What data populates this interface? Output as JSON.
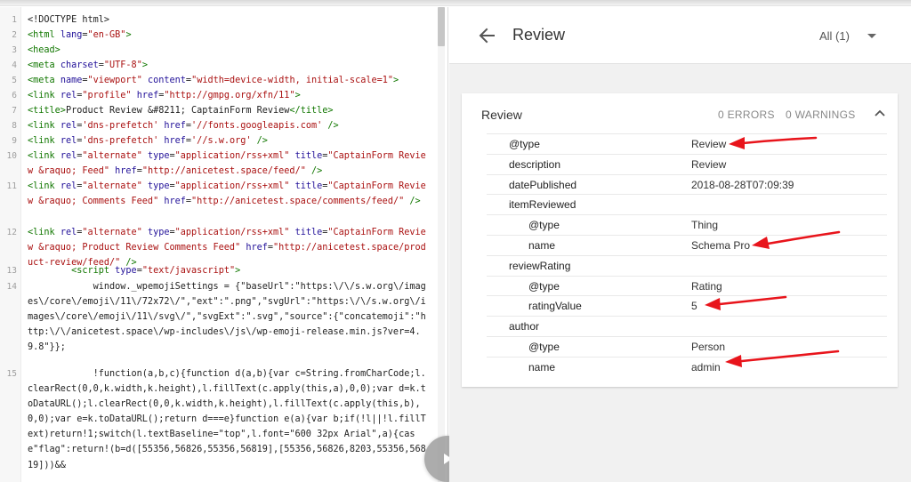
{
  "code": {
    "lines": [
      {
        "n": "1",
        "segs": [
          {
            "t": "<!DOCTYPE html>",
            "c": "plain"
          }
        ]
      },
      {
        "n": "2",
        "segs": [
          {
            "t": "<html ",
            "c": "tag"
          },
          {
            "t": "lang",
            "c": "attr"
          },
          {
            "t": "=",
            "c": "plain"
          },
          {
            "t": "\"en-GB\"",
            "c": "str"
          },
          {
            "t": ">",
            "c": "tag"
          }
        ]
      },
      {
        "n": "3",
        "segs": [
          {
            "t": "<head>",
            "c": "tag"
          }
        ]
      },
      {
        "n": "4",
        "segs": [
          {
            "t": "<meta ",
            "c": "tag"
          },
          {
            "t": "charset",
            "c": "attr"
          },
          {
            "t": "=",
            "c": "plain"
          },
          {
            "t": "\"UTF-8\"",
            "c": "str"
          },
          {
            "t": ">",
            "c": "tag"
          }
        ]
      },
      {
        "n": "5",
        "segs": [
          {
            "t": "<meta ",
            "c": "tag"
          },
          {
            "t": "name",
            "c": "attr"
          },
          {
            "t": "=",
            "c": "plain"
          },
          {
            "t": "\"viewport\"",
            "c": "str"
          },
          {
            "t": " content",
            "c": "attr"
          },
          {
            "t": "=",
            "c": "plain"
          },
          {
            "t": "\"width=device-width, initial-scale=1\"",
            "c": "str"
          },
          {
            "t": ">",
            "c": "tag"
          }
        ]
      },
      {
        "n": "6",
        "segs": [
          {
            "t": "<link ",
            "c": "tag"
          },
          {
            "t": "rel",
            "c": "attr"
          },
          {
            "t": "=",
            "c": "plain"
          },
          {
            "t": "\"profile\"",
            "c": "str"
          },
          {
            "t": " href",
            "c": "attr"
          },
          {
            "t": "=",
            "c": "plain"
          },
          {
            "t": "\"http://gmpg.org/xfn/11\"",
            "c": "str"
          },
          {
            "t": ">",
            "c": "tag"
          }
        ]
      },
      {
        "n": "7",
        "segs": [
          {
            "t": "<title>",
            "c": "tag"
          },
          {
            "t": "Product Review &#8211; CaptainForm Review",
            "c": "plain"
          },
          {
            "t": "</title>",
            "c": "tag"
          }
        ]
      },
      {
        "n": "8",
        "segs": [
          {
            "t": "<link ",
            "c": "tag"
          },
          {
            "t": "rel",
            "c": "attr"
          },
          {
            "t": "=",
            "c": "plain"
          },
          {
            "t": "'dns-prefetch'",
            "c": "str"
          },
          {
            "t": " href",
            "c": "attr"
          },
          {
            "t": "=",
            "c": "plain"
          },
          {
            "t": "'//fonts.googleapis.com'",
            "c": "str"
          },
          {
            "t": " />",
            "c": "tag"
          }
        ]
      },
      {
        "n": "9",
        "segs": [
          {
            "t": "<link ",
            "c": "tag"
          },
          {
            "t": "rel",
            "c": "attr"
          },
          {
            "t": "=",
            "c": "plain"
          },
          {
            "t": "'dns-prefetch'",
            "c": "str"
          },
          {
            "t": " href",
            "c": "attr"
          },
          {
            "t": "=",
            "c": "plain"
          },
          {
            "t": "'//s.w.org'",
            "c": "str"
          },
          {
            "t": " />",
            "c": "tag"
          }
        ]
      },
      {
        "n": "10",
        "segs": [
          {
            "t": "<link ",
            "c": "tag"
          },
          {
            "t": "rel",
            "c": "attr"
          },
          {
            "t": "=",
            "c": "plain"
          },
          {
            "t": "\"alternate\"",
            "c": "str"
          },
          {
            "t": " type",
            "c": "attr"
          },
          {
            "t": "=",
            "c": "plain"
          },
          {
            "t": "\"application/rss+xml\"",
            "c": "str"
          },
          {
            "t": " title",
            "c": "attr"
          },
          {
            "t": "=",
            "c": "plain"
          },
          {
            "t": "\"CaptainForm Review &raquo; Feed\"",
            "c": "str"
          },
          {
            "t": " href",
            "c": "attr"
          },
          {
            "t": "=",
            "c": "plain"
          },
          {
            "t": "\"http://anicetest.space/feed/\"",
            "c": "str"
          },
          {
            "t": " />",
            "c": "tag"
          }
        ]
      },
      {
        "n": "11",
        "segs": [
          {
            "t": "<link ",
            "c": "tag"
          },
          {
            "t": "rel",
            "c": "attr"
          },
          {
            "t": "=",
            "c": "plain"
          },
          {
            "t": "\"alternate\"",
            "c": "str"
          },
          {
            "t": " type",
            "c": "attr"
          },
          {
            "t": "=",
            "c": "plain"
          },
          {
            "t": "\"application/rss+xml\"",
            "c": "str"
          },
          {
            "t": " title",
            "c": "attr"
          },
          {
            "t": "=",
            "c": "plain"
          },
          {
            "t": "\"CaptainForm Review &raquo; Comments Feed\"",
            "c": "str"
          },
          {
            "t": " href",
            "c": "attr"
          },
          {
            "t": "=",
            "c": "plain"
          },
          {
            "t": "\"http://anicetest.space/comments/feed/\"",
            "c": "str"
          },
          {
            "t": " />",
            "c": "tag"
          }
        ]
      },
      {
        "n": "12",
        "segs": [
          {
            "t": "<link ",
            "c": "tag"
          },
          {
            "t": "rel",
            "c": "attr"
          },
          {
            "t": "=",
            "c": "plain"
          },
          {
            "t": "\"alternate\"",
            "c": "str"
          },
          {
            "t": " type",
            "c": "attr"
          },
          {
            "t": "=",
            "c": "plain"
          },
          {
            "t": "\"application/rss+xml\"",
            "c": "str"
          },
          {
            "t": " title",
            "c": "attr"
          },
          {
            "t": "=",
            "c": "plain"
          },
          {
            "t": "\"CaptainForm Review &raquo; Product Review Comments Feed\"",
            "c": "str"
          },
          {
            "t": " href",
            "c": "attr"
          },
          {
            "t": "=",
            "c": "plain"
          },
          {
            "t": "\"http://anicetest.space/product-review/feed/\"",
            "c": "str"
          },
          {
            "t": " />",
            "c": "tag"
          }
        ]
      },
      {
        "n": "13",
        "segs": [
          {
            "t": "        <script ",
            "c": "tag"
          },
          {
            "t": "type",
            "c": "attr"
          },
          {
            "t": "=",
            "c": "plain"
          },
          {
            "t": "\"text/javascript\"",
            "c": "str"
          },
          {
            "t": ">",
            "c": "tag"
          }
        ]
      },
      {
        "n": "14",
        "segs": [
          {
            "t": "            window._wpemojiSettings = {\"baseUrl\":\"https:\\/\\/s.w.org\\/images\\/core\\/emoji\\/11\\/72x72\\/\",\"ext\":\".png\",\"svgUrl\":\"https:\\/\\/s.w.org\\/images\\/core\\/emoji\\/11\\/svg\\/\",\"svgExt\":\".svg\",\"source\":{\"concatemoji\":\"http:\\/\\/anicetest.space\\/wp-includes\\/js\\/wp-emoji-release.min.js?ver=4.9.8\"}};",
            "c": "plain"
          }
        ]
      },
      {
        "n": "15",
        "segs": [
          {
            "t": "            !function(a,b,c){function d(a,b){var c=String.fromCharCode;l.clearRect(0,0,k.width,k.height),l.fillText(c.apply(this,a),0,0);var d=k.toDataURL();l.clearRect(0,0,k.width,k.height),l.fillText(c.apply(this,b),0,0);var e=k.toDataURL();return d===e}function e(a){var b;if(!l||!l.fillText)return!1;switch(l.textBaseline=\"top\",l.font=\"600 32px Arial\",a){case\"flag\":return!(b=d([55356,56826,55356,56819],[55356,56826,8203,55356,56819]))&&",
            "c": "plain"
          }
        ]
      }
    ]
  },
  "results": {
    "title": "Review",
    "filter": "All (1)",
    "card": {
      "title": "Review",
      "errors": "0 ERRORS",
      "warnings": "0 WARNINGS",
      "rows": [
        {
          "key": "@type",
          "value": "Review",
          "indent": 0
        },
        {
          "key": "description",
          "value": "Review",
          "indent": 0
        },
        {
          "key": "datePublished",
          "value": "2018-08-28T07:09:39",
          "indent": 0
        },
        {
          "key": "itemReviewed",
          "value": "",
          "indent": 0
        },
        {
          "key": "@type",
          "value": "Thing",
          "indent": 1
        },
        {
          "key": "name",
          "value": "Schema Pro",
          "indent": 1
        },
        {
          "key": "reviewRating",
          "value": "",
          "indent": 0
        },
        {
          "key": "@type",
          "value": "Rating",
          "indent": 1
        },
        {
          "key": "ratingValue",
          "value": "5",
          "indent": 1
        },
        {
          "key": "author",
          "value": "",
          "indent": 0
        },
        {
          "key": "@type",
          "value": "Person",
          "indent": 1
        },
        {
          "key": "name",
          "value": "admin",
          "indent": 1
        }
      ]
    }
  },
  "colors": {
    "annotation_arrow": "#e8141b",
    "tag": "#117700",
    "attr": "#221199",
    "string": "#aa1111"
  },
  "icons": {
    "back": "arrow-left-icon",
    "filter": "caret-down-icon",
    "collapse": "chevron-up-icon",
    "play": "play-icon"
  }
}
